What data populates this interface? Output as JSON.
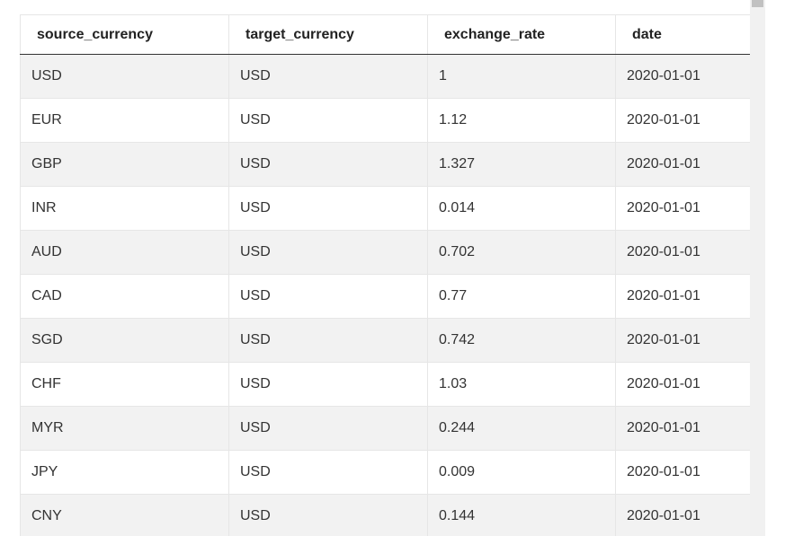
{
  "table": {
    "headers": [
      "source_currency",
      "target_currency",
      "exchange_rate",
      "date"
    ],
    "rows": [
      [
        "USD",
        "USD",
        "1",
        "2020-01-01"
      ],
      [
        "EUR",
        "USD",
        "1.12",
        "2020-01-01"
      ],
      [
        "GBP",
        "USD",
        "1.327",
        "2020-01-01"
      ],
      [
        "INR",
        "USD",
        "0.014",
        "2020-01-01"
      ],
      [
        "AUD",
        "USD",
        "0.702",
        "2020-01-01"
      ],
      [
        "CAD",
        "USD",
        "0.77",
        "2020-01-01"
      ],
      [
        "SGD",
        "USD",
        "0.742",
        "2020-01-01"
      ],
      [
        "CHF",
        "USD",
        "1.03",
        "2020-01-01"
      ],
      [
        "MYR",
        "USD",
        "0.244",
        "2020-01-01"
      ],
      [
        "JPY",
        "USD",
        "0.009",
        "2020-01-01"
      ],
      [
        "CNY",
        "USD",
        "0.144",
        "2020-01-01"
      ]
    ]
  },
  "colors": {
    "stripe": "#f2f2f2",
    "border": "#e6e6e6",
    "header_rule": "#333333",
    "text": "#333333",
    "scrollbar_track": "#f1f1f1",
    "scrollbar_thumb": "#c1c1c1"
  }
}
